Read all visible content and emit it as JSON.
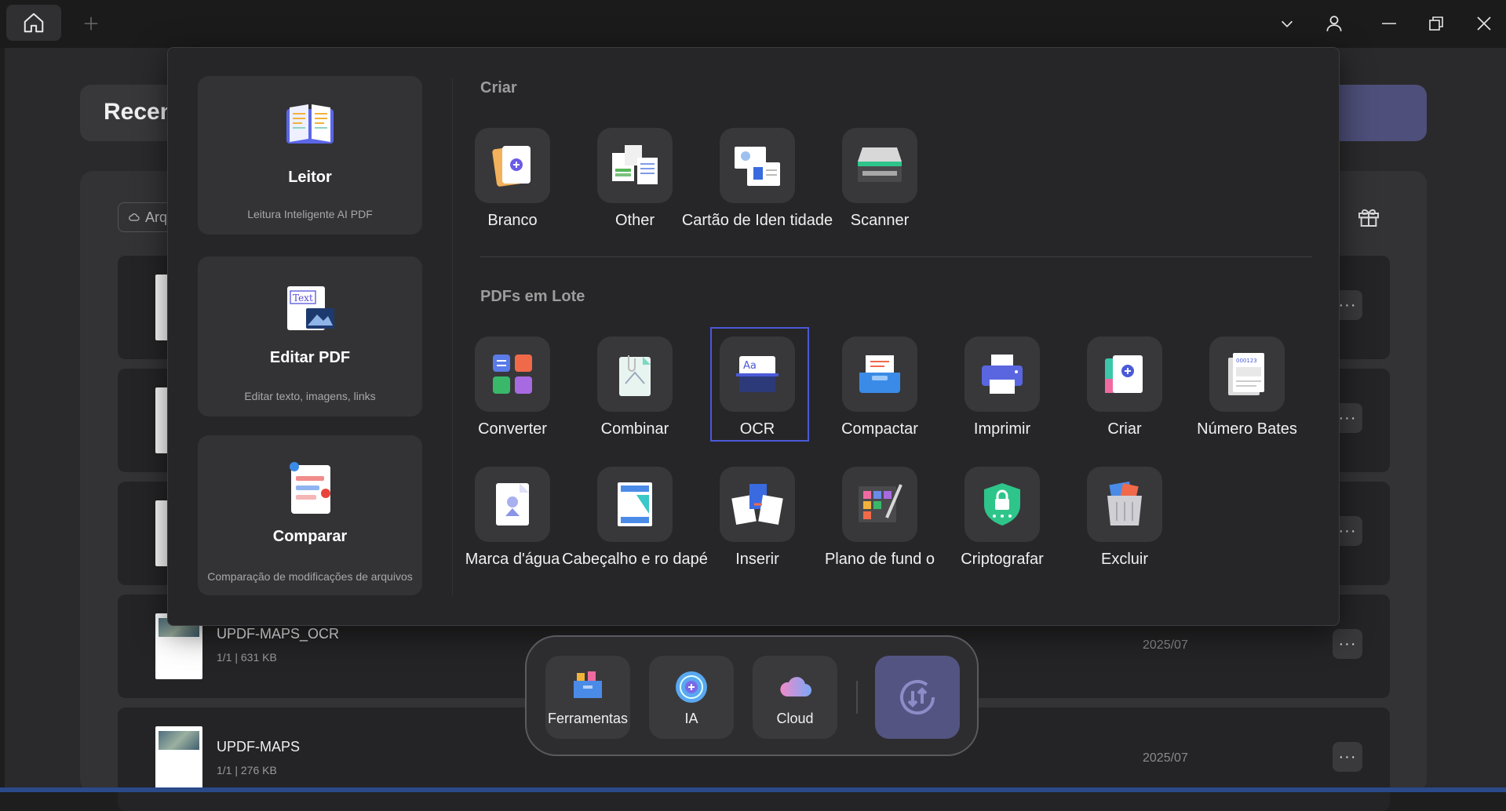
{
  "titlebar": {
    "icons": [
      "home-icon",
      "plus-icon",
      "chevron-down-icon",
      "user-icon",
      "minimize-icon",
      "restore-icon",
      "close-icon"
    ]
  },
  "background": {
    "recent_title": "Recen",
    "filter_label": "Arq",
    "files": [
      {
        "name": "UPDF-MAPS_OCR",
        "meta": "1/1 | 631 KB",
        "date": "2025/07"
      },
      {
        "name": "UPDF-MAPS",
        "meta": "1/1 | 276 KB",
        "date": "2025/07"
      }
    ],
    "more_label": "···"
  },
  "popup": {
    "cards": [
      {
        "title": "Leitor",
        "subtitle": "Leitura Inteligente AI PDF"
      },
      {
        "title": "Editar PDF",
        "subtitle": "Editar texto, imagens, links"
      },
      {
        "title": "Comparar",
        "subtitle": "Comparação de modificações de arquivos"
      }
    ],
    "edit_icon_text": "Text",
    "create_section": {
      "title": "Criar",
      "items": [
        {
          "label": "Branco"
        },
        {
          "label": "Other"
        },
        {
          "label": "Cartão de Iden tidade"
        },
        {
          "label": "Scanner"
        }
      ]
    },
    "batch_section": {
      "title": "PDFs em Lote",
      "items": [
        {
          "label": "Converter"
        },
        {
          "label": "Combinar"
        },
        {
          "label": "OCR"
        },
        {
          "label": "Compactar"
        },
        {
          "label": "Imprimir"
        },
        {
          "label": "Criar"
        },
        {
          "label": "Número Bates"
        },
        {
          "label": "Marca d'água"
        },
        {
          "label": "Cabeçalho e ro dapé"
        },
        {
          "label": "Inserir"
        },
        {
          "label": "Plano de fund o"
        },
        {
          "label": "Criptografar"
        },
        {
          "label": "Excluir"
        }
      ]
    },
    "ocr_icon_text": "Aa",
    "bates_icon_text": "000123"
  },
  "dock": {
    "items": [
      {
        "label": "Ferramentas"
      },
      {
        "label": "IA"
      },
      {
        "label": "Cloud"
      }
    ]
  },
  "colors": {
    "accent": "#4a58d8",
    "toggle": "#545482",
    "background": "#1e1e1f"
  }
}
